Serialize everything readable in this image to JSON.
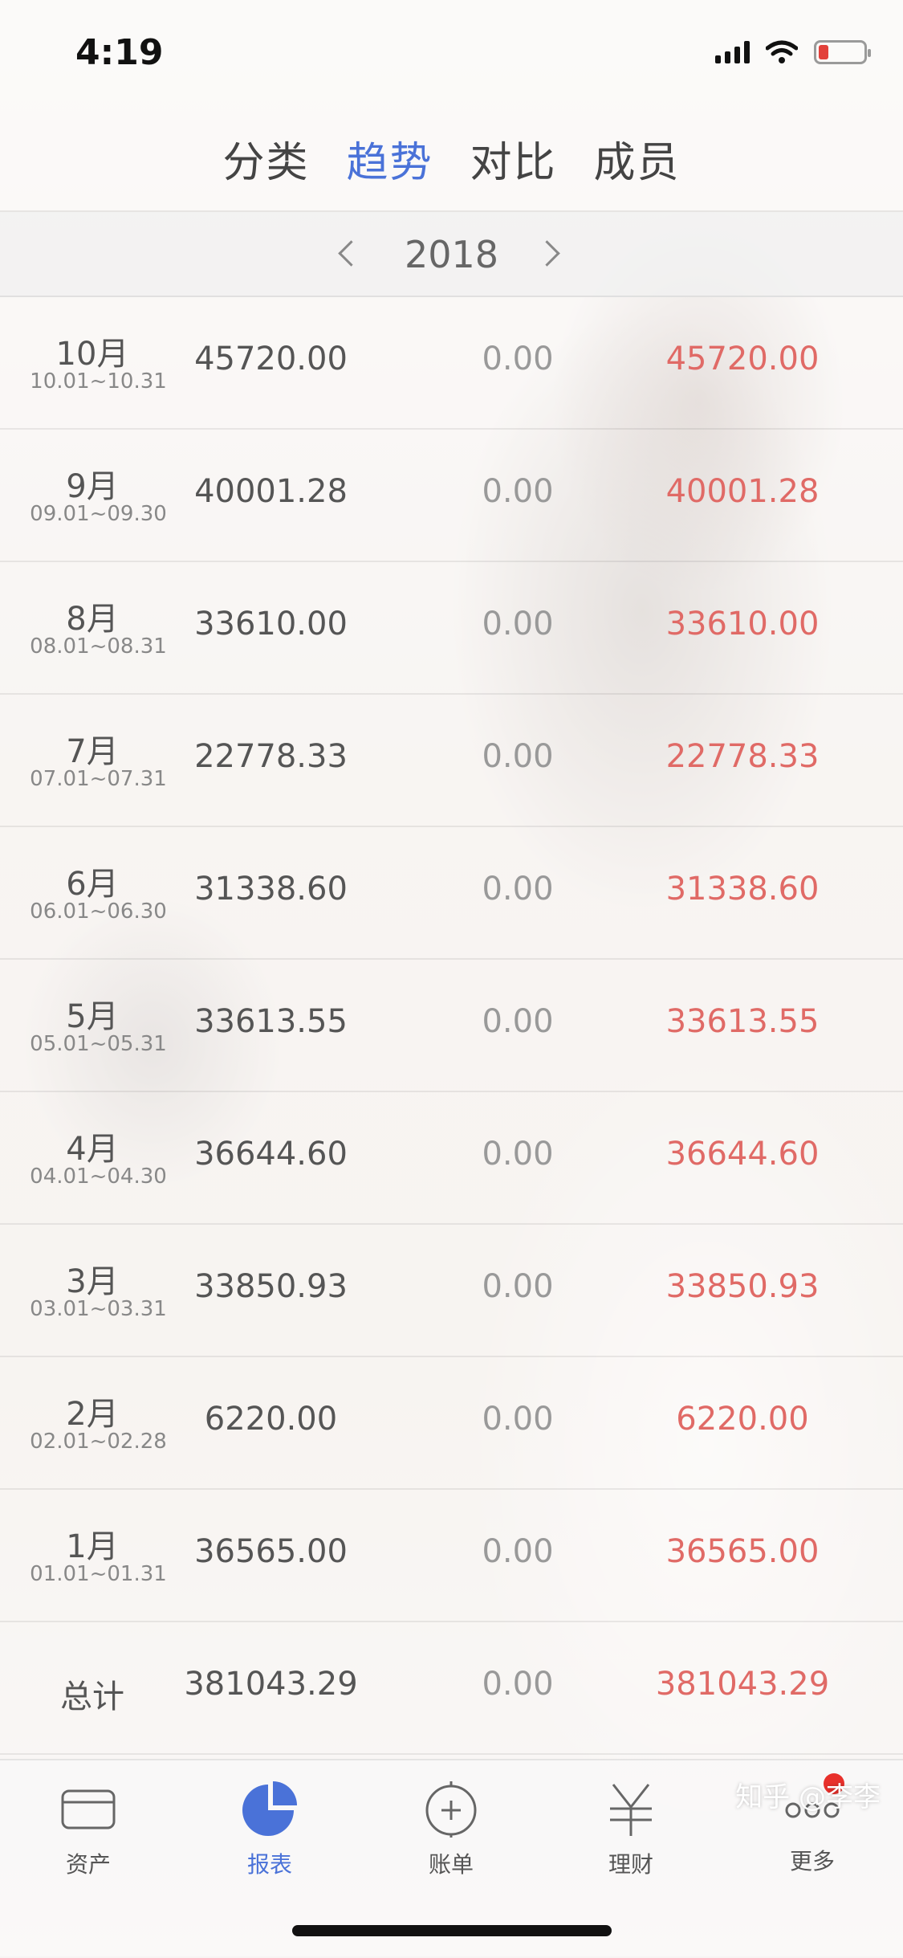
{
  "status": {
    "time": "4:19"
  },
  "tabs": [
    {
      "label": "分类",
      "active": false
    },
    {
      "label": "趋势",
      "active": true
    },
    {
      "label": "对比",
      "active": false
    },
    {
      "label": "成员",
      "active": false
    }
  ],
  "year": "2018",
  "rows": [
    {
      "month": "10月",
      "range": "10.01~10.31",
      "income": "45720.00",
      "expense": "0.00",
      "balance": "45720.00"
    },
    {
      "month": "9月",
      "range": "09.01~09.30",
      "income": "40001.28",
      "expense": "0.00",
      "balance": "40001.28"
    },
    {
      "month": "8月",
      "range": "08.01~08.31",
      "income": "33610.00",
      "expense": "0.00",
      "balance": "33610.00"
    },
    {
      "month": "7月",
      "range": "07.01~07.31",
      "income": "22778.33",
      "expense": "0.00",
      "balance": "22778.33"
    },
    {
      "month": "6月",
      "range": "06.01~06.30",
      "income": "31338.60",
      "expense": "0.00",
      "balance": "31338.60"
    },
    {
      "month": "5月",
      "range": "05.01~05.31",
      "income": "33613.55",
      "expense": "0.00",
      "balance": "33613.55"
    },
    {
      "month": "4月",
      "range": "04.01~04.30",
      "income": "36644.60",
      "expense": "0.00",
      "balance": "36644.60"
    },
    {
      "month": "3月",
      "range": "03.01~03.31",
      "income": "33850.93",
      "expense": "0.00",
      "balance": "33850.93"
    },
    {
      "month": "2月",
      "range": "02.01~02.28",
      "income": "6220.00",
      "expense": "0.00",
      "balance": "6220.00"
    },
    {
      "month": "1月",
      "range": "01.01~01.31",
      "income": "36565.00",
      "expense": "0.00",
      "balance": "36565.00"
    }
  ],
  "total": {
    "label": "总计",
    "income": "381043.29",
    "expense": "0.00",
    "balance": "381043.29"
  },
  "tab_bar": [
    {
      "label": "资产",
      "icon": "card-icon",
      "active": false
    },
    {
      "label": "报表",
      "icon": "pie-chart-icon",
      "active": true
    },
    {
      "label": "账单",
      "icon": "add-circle-icon",
      "active": false
    },
    {
      "label": "理财",
      "icon": "yen-icon",
      "active": false
    },
    {
      "label": "更多",
      "icon": "more-dots-icon",
      "active": false,
      "badge": true
    }
  ],
  "watermark": "知乎 @李李",
  "colors": {
    "accent": "#4a72d8",
    "balance": "#e06a66",
    "badge": "#e8302b"
  }
}
